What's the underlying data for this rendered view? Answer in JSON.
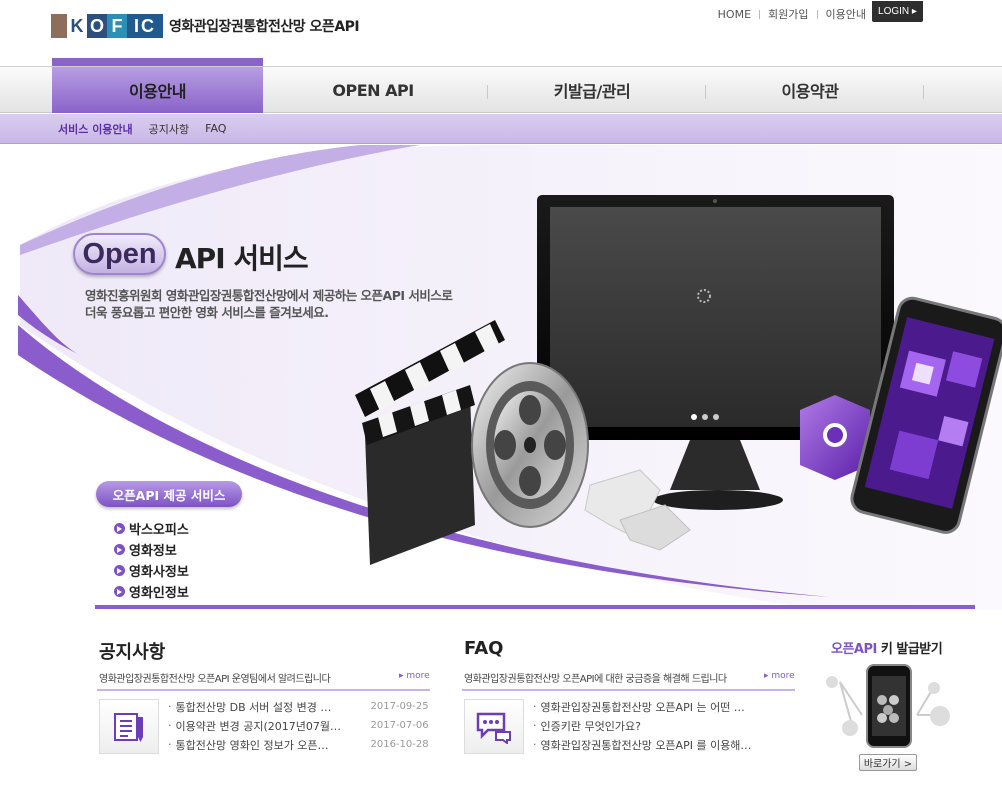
{
  "header": {
    "logo_letters": "KOFIC",
    "logo_parts": [
      "K",
      "O",
      "F",
      "IC"
    ],
    "site_title": "영화관입장권통합전산망 오픈API",
    "utility": [
      "HOME",
      "회원가입",
      "이용안내"
    ],
    "login_label": "LOGIN ▸"
  },
  "gnb": {
    "items": [
      "이용안내",
      "OPEN API",
      "키발급/관리",
      "이용약관"
    ]
  },
  "submenu": {
    "items": [
      "서비스 이용안내",
      "공지사항",
      "FAQ"
    ]
  },
  "hero": {
    "badge": "Open",
    "title": "API 서비스",
    "desc_line1": "영화진흥위원회 영화관입장권통합전산망에서 제공하는 오픈API 서비스로",
    "desc_line2": "더욱 풍요롭고 편안한 영화 서비스를 즐겨보세요.",
    "services_title": "오픈API 제공 서비스",
    "services": [
      "박스오피스",
      "영화정보",
      "영화사정보",
      "영화인정보"
    ]
  },
  "notice": {
    "title": "공지사항",
    "subtitle": "영화관입장권통합전산망 오픈API 운영팀에서 알려드립니다",
    "more": "▸ more",
    "items": [
      {
        "text": "통합전산망 DB 서버 설정 변경 …",
        "date": "2017-09-25"
      },
      {
        "text": "이용약관 변경 공지(2017년07월…",
        "date": "2017-07-06"
      },
      {
        "text": "통합전산망 영화인 정보가 오픈…",
        "date": "2016-10-28"
      }
    ]
  },
  "faq": {
    "title": "FAQ",
    "subtitle": "영화관입장권통합전산망 오픈API에 대한 궁금증을 해결해 드립니다",
    "more": "▸ more",
    "items": [
      "영화관입장권통합전산망 오픈API 는 어떤 …",
      "인증키란 무엇인가요?",
      "영화관입장권통합전산망 오픈API 를 이용해…"
    ]
  },
  "key": {
    "title_hl": "오픈API",
    "title_rest": " 키 발급받기",
    "button": "바로가기 >"
  },
  "colors": {
    "accent": "#8a5ccc",
    "accent_dark": "#7d52c4",
    "submenu_bg": "#d3c5ec"
  }
}
